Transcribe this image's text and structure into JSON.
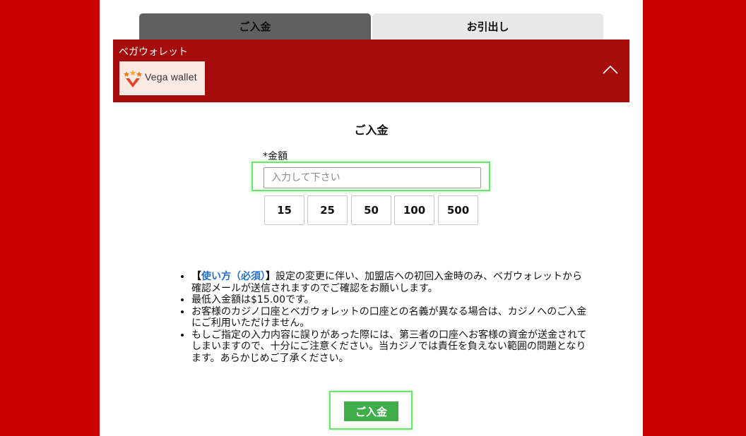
{
  "tabs": {
    "deposit": "ご入金",
    "withdraw": "お引出し"
  },
  "wallet": {
    "name": "ベガウォレット",
    "logo_text": "Vega wallet"
  },
  "form": {
    "title": "ご入金",
    "amount_label": "*金額",
    "amount_placeholder": "入力して下さい",
    "presets": [
      "15",
      "25",
      "50",
      "100",
      "500"
    ],
    "submit_label": "ご入金"
  },
  "notes": {
    "item1_emph_open": "【",
    "item1_emph_blue": "使い方（必須）",
    "item1_emph_close": "】",
    "item1_text": "設定の変更に伴い、加盟店への初回入金時のみ、ベガウォレットから確認メールが送信されますのでご確認をお願いします。",
    "item2": "最低入金額は$15.00です。",
    "item3": "お客様のカジノ口座とベガウォレットの口座との名義が異なる場合は、カジノへのご入金にご利用いただけません。",
    "item4": "もしご指定の入力内容に誤りがあった際には、第三者の口座へお客様の資金が送金されてしまいますので、十分にご注意ください。当カジノでは責任を負えない範囲の問題となります。あらかじめご了承ください。"
  },
  "colors": {
    "background_red": "#cc0000",
    "wallet_bar": "#a50d0d",
    "submit_green": "#3fae4a",
    "highlight_green": "#6fe36f",
    "link_blue": "#1e6fd0"
  }
}
